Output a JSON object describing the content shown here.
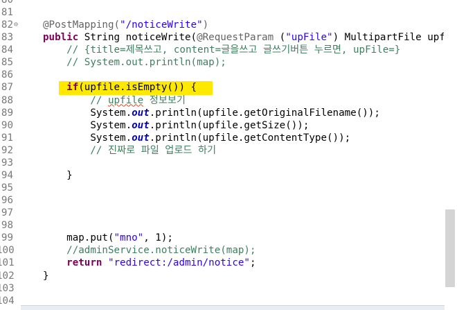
{
  "editor": {
    "lines": [
      {
        "num": "80",
        "segments": []
      },
      {
        "num": "81",
        "segments": []
      },
      {
        "num": "82",
        "fold": "⊖",
        "segments": [
          {
            "t": "@PostMapping(",
            "cls": "a"
          },
          {
            "t": "\"/noticeWrite\"",
            "cls": "s"
          },
          {
            "t": ")",
            "cls": "a"
          }
        ]
      },
      {
        "num": "83",
        "segments": [
          {
            "t": "public",
            "cls": "k"
          },
          {
            "t": " String noticeWrite("
          },
          {
            "t": "@RequestParam",
            "cls": "a"
          },
          {
            "t": " ("
          },
          {
            "t": "\"upFile\"",
            "cls": "s"
          },
          {
            "t": ") MultipartFile upfile,"
          }
        ]
      },
      {
        "num": "84",
        "segments": [
          {
            "t": "    // {title=제목쓰고, content=글을쓰고 글쓰기버튼 누르면, upFile=}",
            "cls": "c"
          }
        ]
      },
      {
        "num": "85",
        "segments": [
          {
            "t": "    // System.out.println(map);",
            "cls": "c"
          }
        ]
      },
      {
        "num": "86",
        "segments": []
      },
      {
        "num": "87",
        "segments": [
          {
            "t": "    "
          },
          {
            "t": "if",
            "cls": "k"
          },
          {
            "t": "(upfile.isEmpty()) {"
          }
        ]
      },
      {
        "num": "88",
        "segments": [
          {
            "t": "        // ",
            "cls": "c"
          },
          {
            "t": "upfile",
            "cls": "c squig"
          },
          {
            "t": " 정보보기",
            "cls": "c"
          }
        ]
      },
      {
        "num": "89",
        "segments": [
          {
            "t": "        System."
          },
          {
            "t": "out",
            "cls": "st"
          },
          {
            "t": ".println(upfile.getOriginalFilename());"
          }
        ]
      },
      {
        "num": "90",
        "segments": [
          {
            "t": "        System."
          },
          {
            "t": "out",
            "cls": "st"
          },
          {
            "t": ".println(upfile.getSize());"
          }
        ]
      },
      {
        "num": "91",
        "segments": [
          {
            "t": "        System."
          },
          {
            "t": "out",
            "cls": "st"
          },
          {
            "t": ".println(upfile.getContentType());"
          }
        ]
      },
      {
        "num": "92",
        "segments": [
          {
            "t": "        // 진짜로 파일 업로드 하기",
            "cls": "c"
          }
        ]
      },
      {
        "num": "93",
        "segments": []
      },
      {
        "num": "94",
        "segments": [
          {
            "t": "    }"
          }
        ]
      },
      {
        "num": "95",
        "segments": []
      },
      {
        "num": "96",
        "segments": []
      },
      {
        "num": "97",
        "segments": []
      },
      {
        "num": "98",
        "segments": []
      },
      {
        "num": "99",
        "segments": [
          {
            "t": "    map.put("
          },
          {
            "t": "\"mno\"",
            "cls": "s"
          },
          {
            "t": ", 1);"
          }
        ]
      },
      {
        "num": "100",
        "segments": [
          {
            "t": "    //adminService.noticeWrite(map);",
            "cls": "c"
          }
        ]
      },
      {
        "num": "101",
        "segments": [
          {
            "t": "    "
          },
          {
            "t": "return",
            "cls": "k"
          },
          {
            "t": " "
          },
          {
            "t": "\"redirect:/admin/notice\"",
            "cls": "s"
          },
          {
            "t": ";"
          }
        ]
      },
      {
        "num": "102",
        "segments": [
          {
            "t": "}"
          }
        ]
      },
      {
        "num": "103",
        "segments": []
      },
      {
        "num": "104",
        "segments": []
      }
    ]
  },
  "colors": {
    "keyword": "#7f0055",
    "string": "#2a00ff",
    "comment": "#3f7f5f",
    "annotation": "#646464",
    "highlight": "#ffe900"
  }
}
